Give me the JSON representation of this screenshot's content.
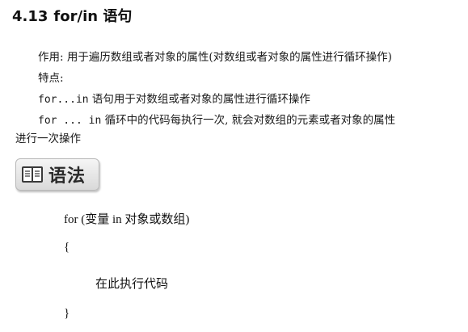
{
  "section": {
    "number": "4.13",
    "title": "for/in 语句"
  },
  "body": {
    "line1": "作用: 用于遍历数组或者对象的属性(对数组或者对象的属性进行循环操作)",
    "line2": "特点:",
    "line3_code": "for...in",
    "line3_text": " 语句用于对数组或者对象的属性进行循环操作",
    "line4_code": "for ... in",
    "line4_text": " 循环中的代码每执行一次, 就会对数组的元素或者对象的属性",
    "line5": "进行一次操作"
  },
  "badge": {
    "label": "语法",
    "icon": "book-icon"
  },
  "syntax": {
    "line1": "for (变量  in  对象或数组)",
    "open_brace": "{",
    "body": "在此执行代码",
    "close_brace": "}"
  }
}
